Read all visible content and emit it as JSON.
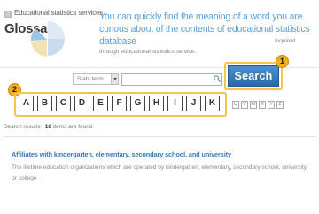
{
  "header": {
    "subtitle": "Educational statistics services",
    "title": "Glossary",
    "intro_main": "You can quickly find the meaning of a word you are curious about of the contents of educational statistics database",
    "intro_sub_inline": "inquired",
    "intro_sub": "through educational statistics service."
  },
  "search": {
    "select_value": "Stats term",
    "input_value": "",
    "button_label": "Search"
  },
  "badges": {
    "one": "1",
    "two": "2"
  },
  "alphabet": {
    "highlighted": [
      "A",
      "B",
      "C",
      "D",
      "E",
      "F",
      "G",
      "H",
      "I",
      "J",
      "K"
    ],
    "small": [
      "U",
      "V",
      "W",
      "X",
      "Y",
      "Z"
    ]
  },
  "results": {
    "prefix": "Search results : ",
    "count": "16",
    "suffix": " items are found",
    "items": [
      {
        "title": "Affiliates with kindergarten, elementary, secondary school, and university",
        "description": "The lifetime education organizations which are operated by kindergarten, elementary, secondary school, university or college"
      }
    ]
  },
  "colors": {
    "accent_blue": "#5f9fd0",
    "button_blue": "#2b6aa9",
    "highlight_yellow": "#f6c44f",
    "link_blue": "#3878b8"
  }
}
